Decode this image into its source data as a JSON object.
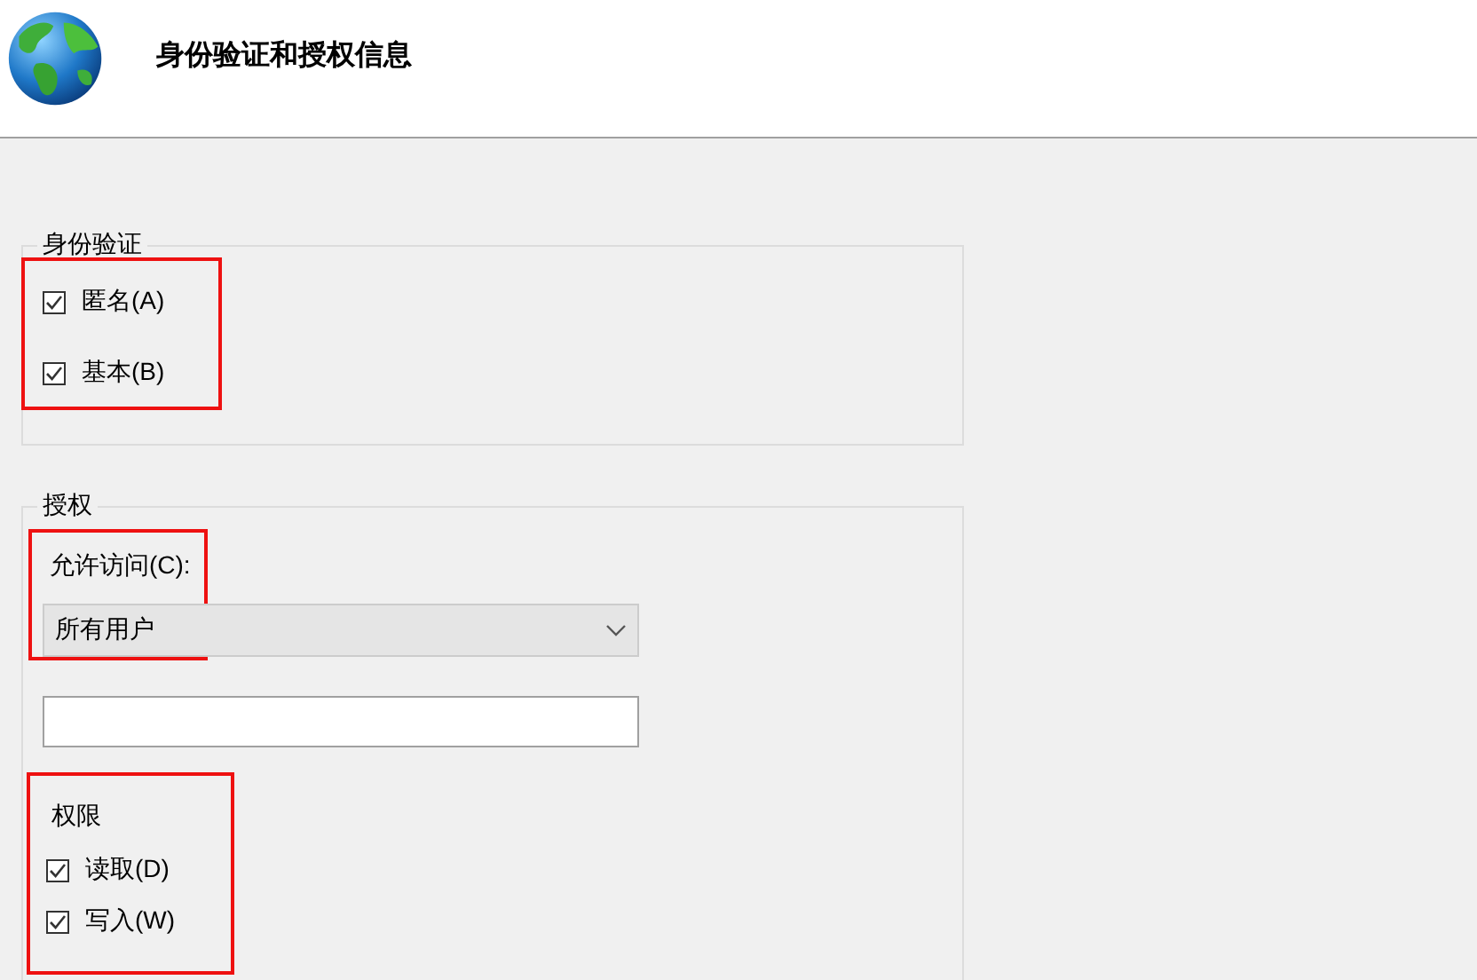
{
  "header": {
    "title": "身份验证和授权信息"
  },
  "authentication": {
    "legend": "身份验证",
    "highlighted": true,
    "options": [
      {
        "label": "匿名(A)",
        "checked": true
      },
      {
        "label": "基本(B)",
        "checked": true
      }
    ]
  },
  "authorization": {
    "legend": "授权",
    "access": {
      "label": "允许访问(C):",
      "value": "所有用户",
      "highlighted": true
    },
    "permissions": {
      "heading": "权限",
      "highlighted": true,
      "options": [
        {
          "label": "读取(D)",
          "checked": true
        },
        {
          "label": "写入(W)",
          "checked": true
        }
      ]
    }
  }
}
